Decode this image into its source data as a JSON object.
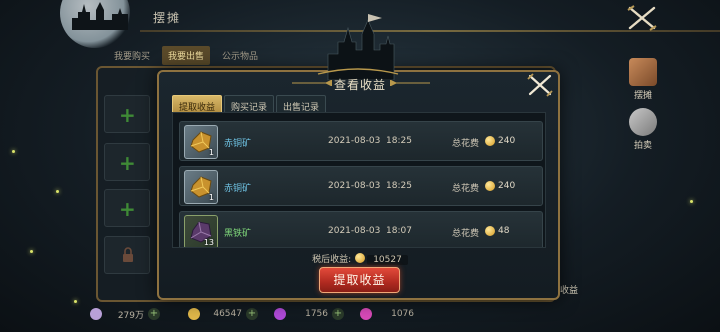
{
  "background": {
    "title": "摆摊",
    "sub_tabs": [
      "我要购买",
      "我要出售",
      "公示物品"
    ],
    "active_sub_tab": 1,
    "right_buttons": [
      {
        "label": "摆摊",
        "icon": "stall-icon"
      },
      {
        "label": "拍卖",
        "icon": "auction-icon"
      }
    ],
    "right_edge_label": "收益",
    "currencies": [
      {
        "value": "279万",
        "color": "#b8a0d8"
      },
      {
        "value": "46547",
        "color": "#e0b84a"
      },
      {
        "value": "1756",
        "color": "#b04ad8"
      },
      {
        "value": "1076",
        "color": "#d84ab8"
      }
    ]
  },
  "modal": {
    "title": "查看收益",
    "tabs": [
      "提取收益",
      "购买记录",
      "出售记录"
    ],
    "active_tab": 0,
    "rows": [
      {
        "name": "赤铜矿",
        "count": "1",
        "date": "2021-08-03",
        "time": "18:25",
        "cost_label": "总花费",
        "cost": "240",
        "rarity": "blue"
      },
      {
        "name": "赤铜矿",
        "count": "1",
        "date": "2021-08-03",
        "time": "18:25",
        "cost_label": "总花费",
        "cost": "240",
        "rarity": "blue"
      },
      {
        "name": "黑铁矿",
        "count": "13",
        "date": "2021-08-03",
        "time": "18:07",
        "cost_label": "总花费",
        "cost": "48",
        "rarity": "green"
      }
    ],
    "tax_label": "税后收益:",
    "tax_value": "10527",
    "withdraw_label": "提取收益"
  },
  "colors": {
    "accent_gold": "#8e7240",
    "withdraw_red": "#c0332a",
    "name_blue": "#6fc3e4",
    "name_green": "#7fd67a"
  }
}
